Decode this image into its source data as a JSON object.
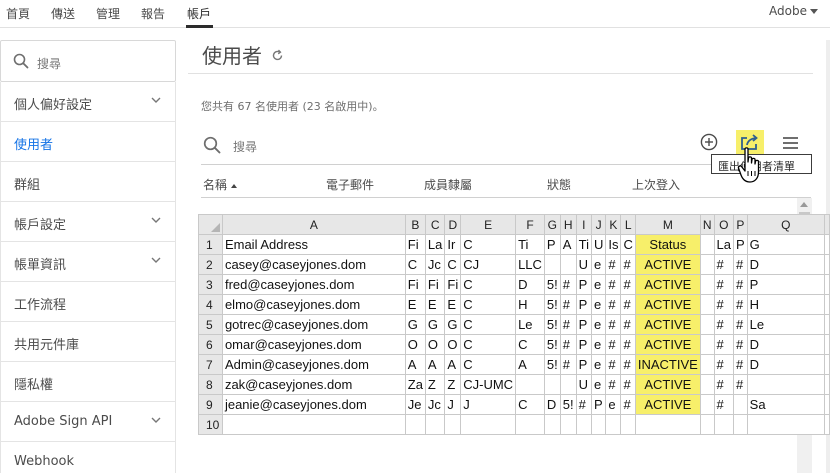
{
  "topnav": {
    "items": [
      "首頁",
      "傳送",
      "管理",
      "報告",
      "帳戶"
    ],
    "active_index": 4,
    "account": "Adobe"
  },
  "sidebar": {
    "search_placeholder": "搜尋",
    "items": [
      {
        "label": "個人偏好設定",
        "chevron": true
      },
      {
        "label": "使用者",
        "chevron": false,
        "selected": true
      },
      {
        "label": "群組",
        "chevron": false
      },
      {
        "label": "帳戶設定",
        "chevron": true
      },
      {
        "label": "帳單資訊",
        "chevron": true
      },
      {
        "label": "工作流程",
        "chevron": false
      },
      {
        "label": "共用元件庫",
        "chevron": false
      },
      {
        "label": "隱私權",
        "chevron": false
      },
      {
        "label": "Adobe Sign API",
        "chevron": true
      },
      {
        "label": "Webhook",
        "chevron": false
      }
    ]
  },
  "main": {
    "title": "使用者",
    "count_text": "您共有 67 名使用者 (23 名啟用中)。",
    "search_placeholder": "搜尋",
    "tooltip": "匯出使用者清單",
    "columns": [
      "名稱",
      "電子郵件",
      "成員隸屬",
      "狀態",
      "上次登入"
    ]
  },
  "colors": {
    "highlight": "#f7ef6a",
    "accent": "#1473e6"
  },
  "icons": {
    "search": "search-icon",
    "refresh": "refresh-icon",
    "add": "add-user-icon",
    "export": "export-icon",
    "menu": "menu-icon",
    "cursor": "hand-cursor-icon"
  },
  "spreadsheet": {
    "column_headers": [
      "A",
      "B",
      "C",
      "D",
      "E",
      "F",
      "G",
      "H",
      "I",
      "J",
      "K",
      "L",
      "M",
      "N",
      "O",
      "P",
      "Q"
    ],
    "row_numbers": [
      "1",
      "2",
      "3",
      "4",
      "5",
      "6",
      "7",
      "8",
      "9",
      "10"
    ],
    "rows": [
      [
        "Email Address",
        "Fi",
        "La",
        "Ir",
        "C",
        "Ti",
        "P",
        "A",
        "Ti",
        "U",
        "Is",
        "C",
        "Status",
        "",
        "La",
        "P",
        "G",
        ""
      ],
      [
        "casey@caseyjones.dom",
        "C",
        "Jc",
        "C",
        "CJ",
        "LLC",
        "",
        "",
        "U",
        "e",
        "#",
        "#",
        "ACTIVE",
        "",
        "#",
        "#",
        "D",
        ""
      ],
      [
        "fred@caseyjones.dom",
        "Fi",
        "Fi",
        "Fi",
        "C",
        "D",
        "5!",
        "#",
        "P",
        "e",
        "#",
        "#",
        "ACTIVE",
        "",
        "#",
        "#",
        "P",
        ""
      ],
      [
        "elmo@caseyjones.dom",
        "E",
        "E",
        "E",
        "C",
        "H",
        "5!",
        "#",
        "P",
        "e",
        "#",
        "#",
        "ACTIVE",
        "",
        "#",
        "#",
        "H",
        ""
      ],
      [
        "gotrec@caseyjones.dom",
        "G",
        "G",
        "G",
        "C",
        "Le",
        "5!",
        "#",
        "P",
        "e",
        "#",
        "#",
        "ACTIVE",
        "",
        "#",
        "#",
        "Le",
        ""
      ],
      [
        "omar@caseyjones.dom",
        "O",
        "O",
        "O",
        "C",
        "C",
        "5!",
        "#",
        "P",
        "e",
        "#",
        "#",
        "ACTIVE",
        "",
        "#",
        "#",
        "D",
        ""
      ],
      [
        "Admin@caseyjones.dom",
        "A",
        "A",
        "A",
        "C",
        "A",
        "5!",
        "#",
        "P",
        "e",
        "#",
        "#",
        "INACTIVE",
        "",
        "#",
        "#",
        "D",
        ""
      ],
      [
        "zak@caseyjones.dom",
        "Za",
        "Z",
        "Z",
        "CJ-UMC",
        "",
        "",
        "",
        "U",
        "e",
        "#",
        "#",
        "ACTIVE",
        "",
        "#",
        "#",
        "",
        ""
      ],
      [
        "jeanie@caseyjones.dom",
        "Je",
        "Jc",
        "J",
        "J",
        "C",
        "D",
        "5!",
        "#",
        "P",
        "e",
        "#",
        "ACTIVE",
        "",
        "#",
        "",
        "Sa",
        ""
      ],
      [
        "",
        "",
        "",
        "",
        "",
        "",
        "",
        "",
        "",
        "",
        "",
        "",
        "",
        "",
        "",
        "",
        "",
        ""
      ]
    ]
  }
}
